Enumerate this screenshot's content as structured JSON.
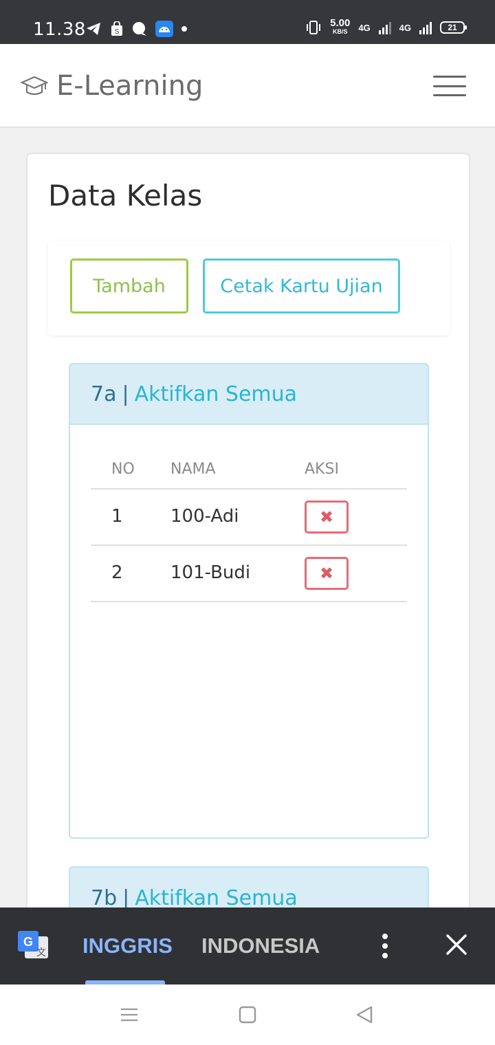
{
  "status_bar": {
    "time": "11.38",
    "speed_value": "5.00",
    "speed_unit": "KB/S",
    "network_1": "4G",
    "network_2": "4G",
    "battery": "21"
  },
  "navbar": {
    "brand": "E-Learning"
  },
  "page": {
    "title": "Data Kelas",
    "buttons": {
      "add_label": "Tambah",
      "print_label": "Cetak Kartu Ujian"
    }
  },
  "classes": [
    {
      "name": "7a",
      "separator": "|",
      "activate_label": "Aktifkan Semua",
      "columns": [
        "NO",
        "NAMA",
        "AKSI"
      ],
      "rows": [
        {
          "no": "1",
          "nama": "100-Adi",
          "action": "✖"
        },
        {
          "no": "2",
          "nama": "101-Budi",
          "action": "✖"
        }
      ]
    },
    {
      "name": "7b",
      "separator": "|",
      "activate_label": "Aktifkan Semua"
    }
  ],
  "translate_bar": {
    "source_lang": "INGGRIS",
    "target_lang": "INDONESIA"
  },
  "colors": {
    "add_button": "#8bc34a",
    "print_button": "#33b8d6",
    "delete_button": "#e05a66",
    "panel_header": "#d9edf7",
    "translate_active": "#8ab4f8"
  }
}
